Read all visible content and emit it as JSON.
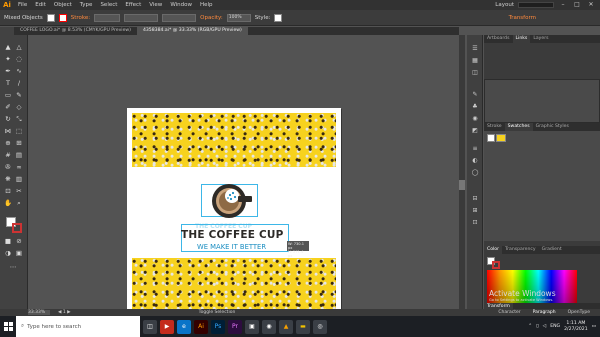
{
  "app": {
    "logo": "Ai"
  },
  "menu": {
    "items": [
      "File",
      "Edit",
      "Object",
      "Type",
      "Select",
      "Effect",
      "View",
      "Window",
      "Help"
    ],
    "workspace": "Layout"
  },
  "controlbar": {
    "mode": "Mixed Objects",
    "stroke_label": "Stroke:",
    "opacity_label": "Opacity:",
    "opacity_value": "100%",
    "style_label": "Style:",
    "transform_label": "Transform"
  },
  "tabs": [
    "COFFEE LOGO.ai* @ 8.53% (CMYK/GPU Preview)",
    "4358384.ai* @ 33.33% (RGB/GPU Preview)"
  ],
  "artwork": {
    "title": "THE COFFEE CUP",
    "title_ghost": "THE COFFEE CUP",
    "subtitle": "WE MAKE IT BETTER",
    "dim_tip_w": "W: 730.1 px",
    "dim_tip_h": "H: 271.4 px"
  },
  "panels": {
    "top_tabs": [
      "Artboards",
      "Links",
      "Layers"
    ],
    "swatch_tabs": [
      "Stroke",
      "Swatches",
      "Graphic Styles"
    ],
    "color_tabs": [
      "Color",
      "Transparency",
      "Gradient"
    ],
    "bottom_tabs": [
      "Transform"
    ],
    "bottom2_tabs": [
      "Character",
      "Paragraph",
      "OpenType"
    ],
    "watermark": "Activate Windows",
    "watermark_sub": "Go to Settings to activate Windows."
  },
  "status": {
    "zoom": "33.33%",
    "tool": "Toggle Selection"
  },
  "taskbar": {
    "search_placeholder": "Type here to search",
    "lang": "ENG",
    "time": "1:11 AM",
    "date": "2/27/2021"
  },
  "colors": {
    "accent": "#ff9a00",
    "selection": "#3db7e8",
    "pattern_yellow": "#f7d21e",
    "subtitle_blue": "#1b8ec2"
  }
}
